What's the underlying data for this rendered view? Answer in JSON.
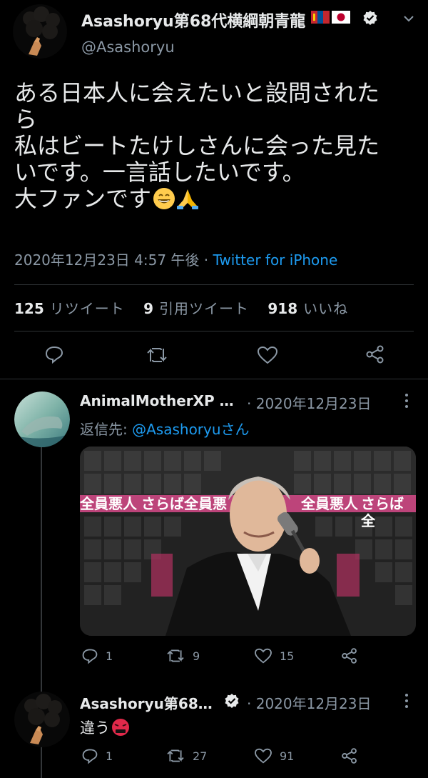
{
  "main_tweet": {
    "display_name": "Asashoryu第68代横綱朝青龍",
    "handle": "@Asashoryu",
    "text_lines": [
      "ある日本人に会えたいと設問された",
      "ら",
      "私はビートたけしさんに会った見た",
      "いです。一言話したいです。",
      "大ファンです"
    ],
    "timestamp": "2020年12月23日 4:57 午後",
    "separator": "·",
    "source": "Twitter for iPhone",
    "stats": {
      "retweets_count": "125",
      "retweets_label": "リツイート",
      "quotes_count": "9",
      "quotes_label": "引用ツイート",
      "likes_count": "918",
      "likes_label": "いいね"
    }
  },
  "reply_1": {
    "display_name": "AnimalMotherXP …",
    "date": "· 2020年12月23日",
    "reply_to_prefix": "返信先: ",
    "reply_to_handle": "@Asashoryuさん",
    "banner_text_left": "全員悪人",
    "banner_text_mid": "さらば全員悪",
    "banner_text_right": "全員悪人",
    "banner_text_far": "さらば全",
    "replies": "1",
    "retweets": "9",
    "likes": "15"
  },
  "reply_2": {
    "display_name": "Asashoryu第68…",
    "date": "· 2020年12月23日",
    "text": "違う",
    "replies": "1",
    "retweets": "27",
    "likes": "91"
  },
  "colors": {
    "background": "#000000",
    "text": "#e7e9ea",
    "secondary": "#8b98a5",
    "link": "#1d9bf0",
    "divider": "#2f3336"
  }
}
